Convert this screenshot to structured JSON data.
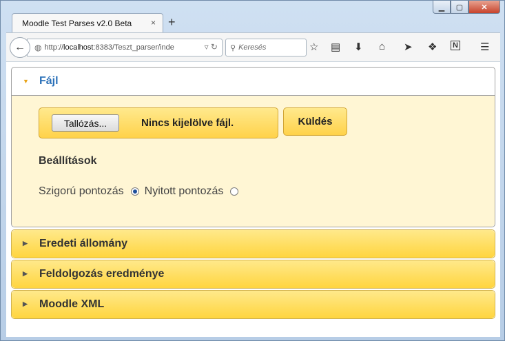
{
  "browser": {
    "tab_title": "Moodle Test Parses v2.0 Beta",
    "tab_close": "×",
    "new_tab": "+",
    "url_prefix": "http://",
    "url_host": "localhost",
    "url_rest": ":8383/Teszt_parser/inde",
    "search_placeholder": "Keresés",
    "icons": [
      "star-icon",
      "reading-list-icon",
      "download-icon",
      "home-icon",
      "send-icon",
      "addon-icon",
      "n-extension-icon",
      "menu-icon"
    ]
  },
  "sections": {
    "file": {
      "title": "Fájl",
      "browse_label": "Tallózás...",
      "file_status": "Nincs kijelölve fájl.",
      "submit_label": "Küldés",
      "settings_title": "Beállítások",
      "radio_strict": "Szigorú pontozás",
      "radio_open": "Nyitott pontozás"
    },
    "original": {
      "title": "Eredeti állomány"
    },
    "result": {
      "title": "Feldolgozás eredménye"
    },
    "xml": {
      "title": "Moodle XML"
    }
  }
}
